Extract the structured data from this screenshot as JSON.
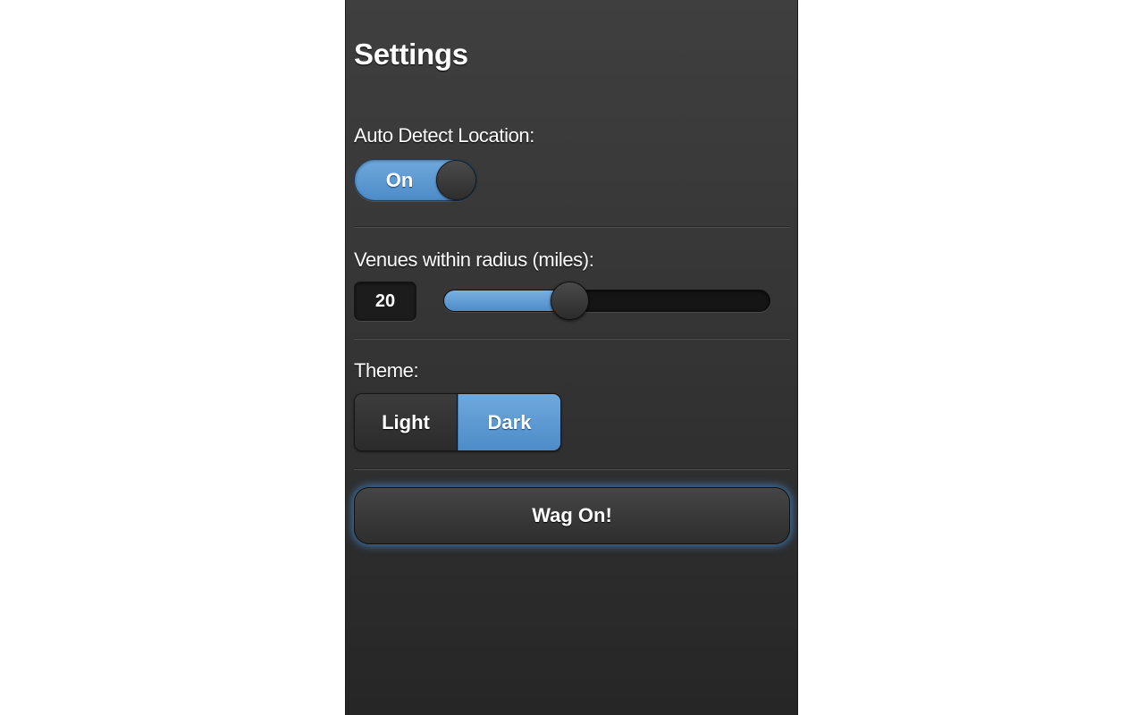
{
  "page": {
    "title": "Settings"
  },
  "location": {
    "label": "Auto Detect Location:",
    "toggle_state": "On"
  },
  "radius": {
    "label": "Venues within radius (miles):",
    "value": "20",
    "fraction": 0.385
  },
  "theme": {
    "label": "Theme:",
    "options": [
      "Light",
      "Dark"
    ],
    "selected": "Dark"
  },
  "actions": {
    "submit_label": "Wag On!"
  },
  "colors": {
    "accent": "#5a9ad4",
    "glow": "#468cd2",
    "background_top": "#3f3f3f",
    "background_bottom": "#262626"
  }
}
